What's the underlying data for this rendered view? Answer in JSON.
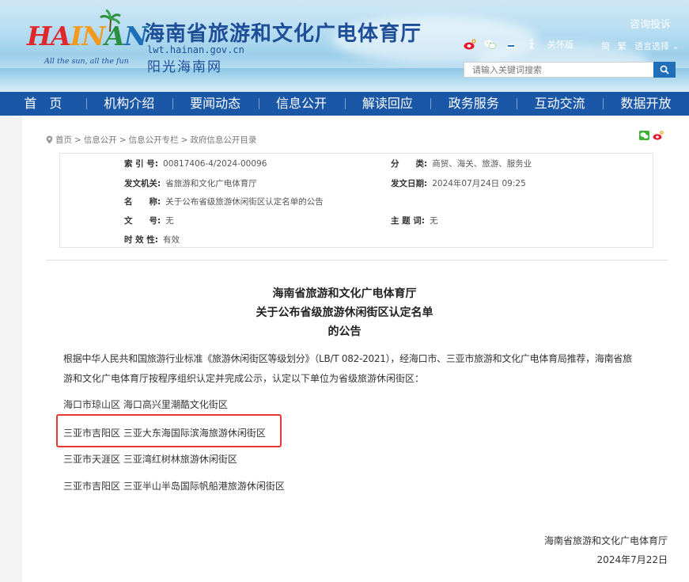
{
  "header": {
    "logo": {
      "letters": [
        "HA",
        "IN",
        "A",
        "N"
      ],
      "slogan": "All the sun, all the fun"
    },
    "title": "海南省旅游和文化广电体育厅",
    "domain": "lwt.hainan.gov.cn",
    "subtitle": "阳光海南网",
    "consult": "咨询投诉",
    "care_mode": "关怀版",
    "lang_simplified": "简",
    "lang_traditional": "繁",
    "lang_select": "语言选择",
    "search_placeholder": "请输入关键词搜索"
  },
  "nav": [
    "首　页",
    "机构介绍",
    "要闻动态",
    "信息公开",
    "解读回应",
    "政务服务",
    "互动交流",
    "数据开放"
  ],
  "breadcrumb": [
    "首页",
    "信息公开",
    "信息公开专栏",
    "政府信息公开目录"
  ],
  "meta": {
    "index_label": "索 引 号:",
    "index_value": "00817406-4/2024-00096",
    "category_label": "分　　类:",
    "category_value": "商贸、海关、旅游、服务业",
    "issuer_label": "发文机关:",
    "issuer_value": "省旅游和文化广电体育厅",
    "date_label": "发文日期:",
    "date_value": "2024年07月24日 09:25",
    "name_label": "名　　称:",
    "name_value": "关于公布省级旅游休闲街区认定名单的公告",
    "docno_label": "文　　号:",
    "docno_value": "无",
    "topic_label": "主 题 词:",
    "topic_value": "无",
    "validity_label": "时 效 性:",
    "validity_value": "有效"
  },
  "article": {
    "title_lines": [
      "海南省旅游和文化广电体育厅",
      "关于公布省级旅游休闲街区认定名单",
      "的公告"
    ],
    "intro_line1": "根据中华人民共和国旅游行业标准《旅游休闲街区等级划分》（LB/T 082-2021），经海口市、三亚市旅游和文化广电体育局推荐，海南省旅",
    "intro_line2": "游和文化广电体育厅按程序组织认定并完成公示，认定以下单位为省级旅游休闲街区：",
    "items": [
      "海口市琼山区 海口高兴里潮酷文化街区",
      "三亚市吉阳区 三亚大东海国际滨海旅游休闲街区",
      "三亚市天涯区 三亚湾红树林旅游休闲街区",
      "三亚市吉阳区 三亚半山半岛国际帆船港旅游休闲街区"
    ],
    "signature": "海南省旅游和文化广电体育厅",
    "sign_date": "2024年7月22日"
  },
  "colors": {
    "nav_bg": "#1a57a7",
    "brand_blue": "#1d4e97",
    "highlight": "#e53935"
  }
}
